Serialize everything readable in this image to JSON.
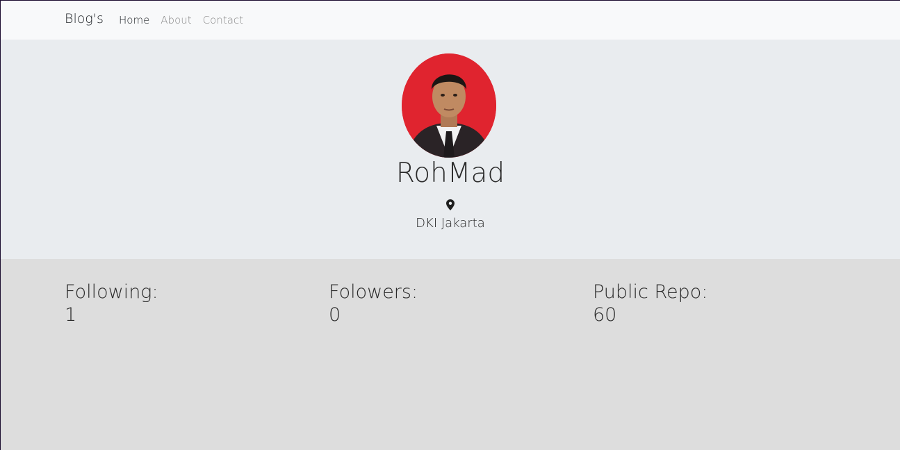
{
  "navbar": {
    "brand": "Blog's",
    "items": [
      {
        "label": "Home",
        "active": true
      },
      {
        "label": "About",
        "active": false
      },
      {
        "label": "Contact",
        "active": false
      }
    ]
  },
  "profile": {
    "name": "RohMad",
    "location_icon": "map-pin-icon",
    "location": "DKI Jakarta",
    "avatar_background": "#e0242f"
  },
  "stats": [
    {
      "label": "Following:",
      "value": "1"
    },
    {
      "label": "Folowers:",
      "value": "0"
    },
    {
      "label": "Public Repo:",
      "value": "60"
    }
  ]
}
